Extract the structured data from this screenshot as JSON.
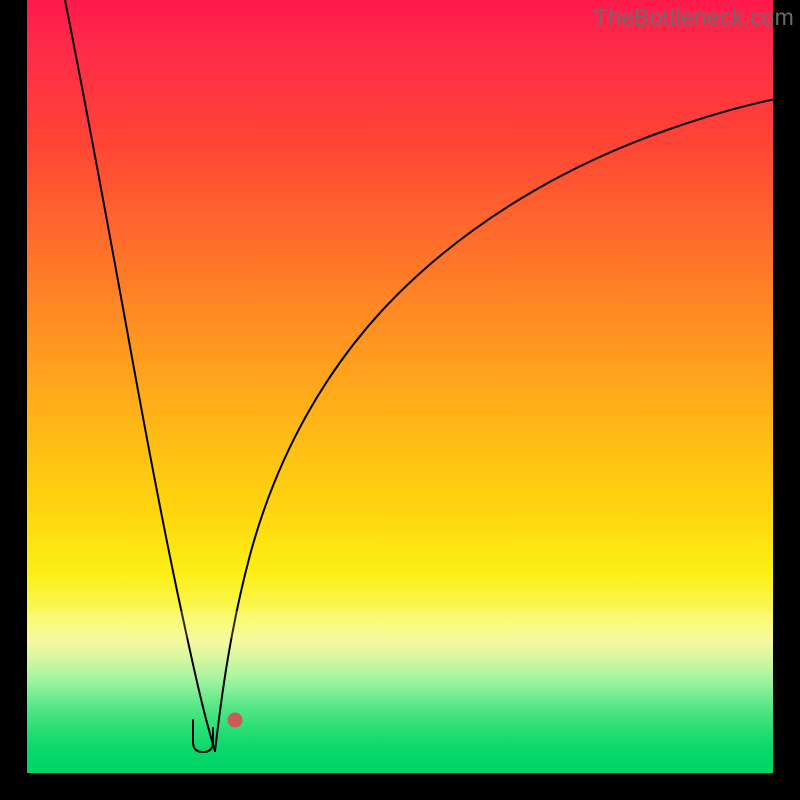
{
  "watermark": "TheBottleneck.com",
  "colors": {
    "frame_background": "#000000",
    "curve_stroke": "#000000",
    "marker_fill": "#cc5a5a",
    "gradient_top": "#ff1a4c",
    "gradient_bottom": "#00d466"
  },
  "chart_data": {
    "type": "line",
    "title": "",
    "xlabel": "",
    "ylabel": "",
    "x_range": [
      0,
      1
    ],
    "y_range": [
      0,
      100
    ],
    "series": [
      {
        "name": "left-curve",
        "x": [
          0.05,
          0.07,
          0.09,
          0.11,
          0.13,
          0.15,
          0.17,
          0.19,
          0.21,
          0.23,
          0.25
        ],
        "y": [
          100,
          89,
          78,
          66,
          55,
          43,
          32,
          21,
          12,
          5,
          0
        ]
      },
      {
        "name": "right-curve",
        "x": [
          0.25,
          0.27,
          0.3,
          0.34,
          0.4,
          0.47,
          0.55,
          0.65,
          0.76,
          0.88,
          1.0
        ],
        "y": [
          0,
          15,
          30,
          42,
          54,
          63,
          70,
          76,
          80.5,
          84,
          87
        ]
      }
    ],
    "marker_u": {
      "x": 0.232,
      "y": 4
    },
    "marker_dot": {
      "x": 0.275,
      "y": 6
    },
    "background_gradient_stops": [
      {
        "pos": 0.0,
        "color": "#ff1a4c"
      },
      {
        "pos": 0.3,
        "color": "#ff6a2c"
      },
      {
        "pos": 0.66,
        "color": "#ffd50e"
      },
      {
        "pos": 0.83,
        "color": "#f4f9a0"
      },
      {
        "pos": 1.0,
        "color": "#00d466"
      }
    ]
  }
}
